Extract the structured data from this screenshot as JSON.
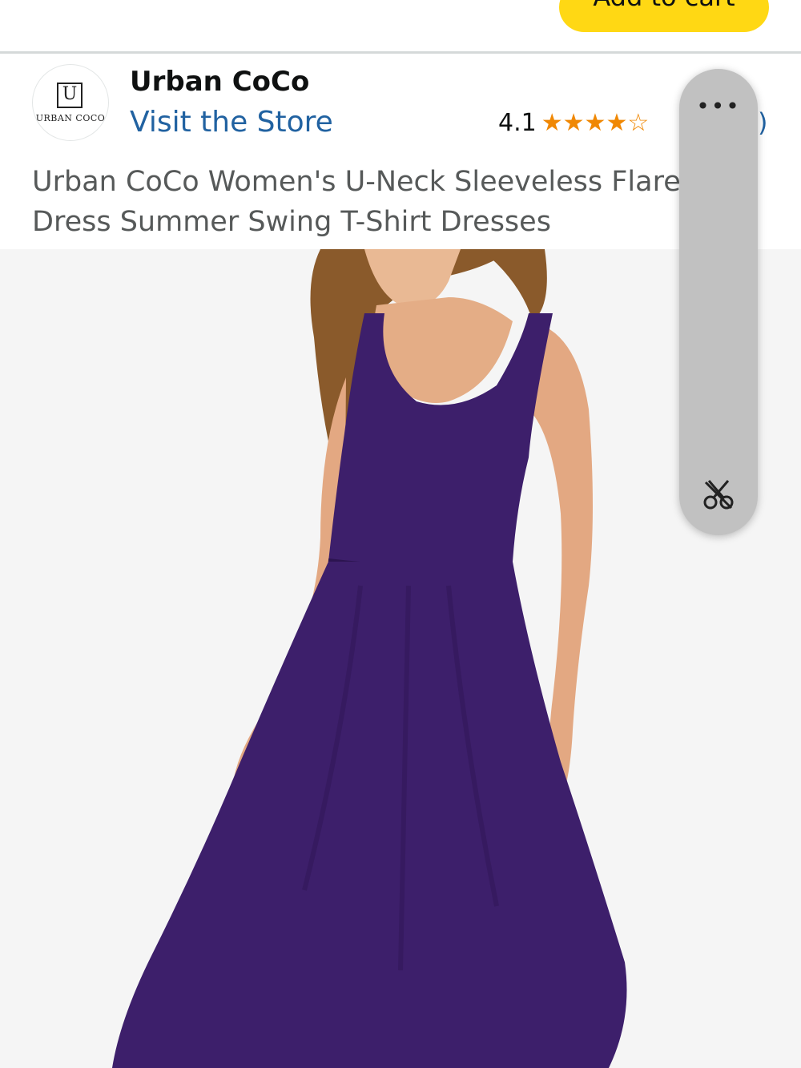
{
  "header": {
    "add_to_cart_label": "Add to cart"
  },
  "brand": {
    "logo_text": "URBAN COCO",
    "logo_glyph": "U",
    "name": "Urban CoCo",
    "visit_store_label": "Visit the Store"
  },
  "rating": {
    "value": "4.1",
    "stars": 4.1,
    "stars_display": [
      "★",
      "★",
      "★",
      "★",
      "☆"
    ],
    "count_tail": ")"
  },
  "product": {
    "title": "Urban CoCo Women's U-Neck Sleeveless Flare      i Dress Summer Swing T-Shirt Dresses",
    "image_alt": "Woman wearing a purple sleeveless flare dress"
  },
  "overlay": {
    "more_icon": "more-horizontal-icon",
    "tool_icon": "scissors-icon",
    "more_glyph": "•••"
  },
  "colors": {
    "accent_yellow": "#ffd814",
    "link_blue": "#2162a1",
    "star_orange": "#f08804",
    "dress_purple": "#3d1f6b"
  }
}
